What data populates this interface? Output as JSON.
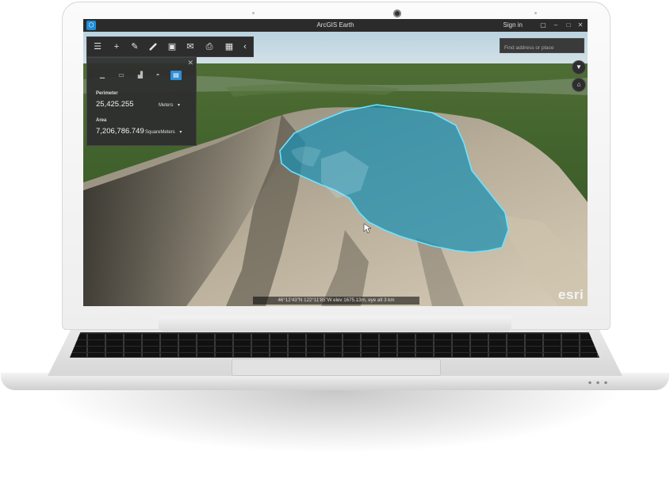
{
  "window": {
    "title": "ArcGIS Earth",
    "sign_in": "Sign in",
    "logo_glyph": "⬡"
  },
  "toolbar": {
    "items": [
      {
        "icon": "layers-list-icon",
        "glyph": "☰"
      },
      {
        "icon": "add-icon",
        "glyph": "+"
      },
      {
        "icon": "draw-icon",
        "glyph": "✎"
      },
      {
        "icon": "measure-icon",
        "glyph": "📏"
      },
      {
        "icon": "picture-icon",
        "glyph": "▣"
      },
      {
        "icon": "email-icon",
        "glyph": "✉"
      },
      {
        "icon": "print-icon",
        "glyph": "⎙"
      },
      {
        "icon": "grid-icon",
        "glyph": "▦"
      },
      {
        "icon": "collapse-icon",
        "glyph": "‹"
      }
    ]
  },
  "search": {
    "placeholder": "Find address or place"
  },
  "nav": {
    "compass_glyph": "▼",
    "home_glyph": "⌂"
  },
  "measure_panel": {
    "close_glyph": "✕",
    "tools": [
      {
        "icon": "measure-distance-icon",
        "glyph": "▁"
      },
      {
        "icon": "measure-area-icon",
        "glyph": "▭"
      },
      {
        "icon": "measure-height-icon",
        "glyph": "▟"
      },
      {
        "icon": "measure-volume-icon",
        "glyph": "◓"
      },
      {
        "icon": "measure-polygon-icon",
        "glyph": "▤",
        "active": true
      }
    ],
    "perimeter_label": "Perimeter",
    "perimeter_value": "25,425.255",
    "perimeter_unit": "Meters",
    "area_label": "Area",
    "area_value": "7,206,786.749",
    "area_unit": "SquareMeters",
    "dropdown_glyph": "▾"
  },
  "status": {
    "coords": "46°12'43\"N  122°11'85\"W  elev 1675.13m,  eye alt 3 km"
  },
  "brand": {
    "esri": "esri"
  },
  "colors": {
    "accent": "#2f8fd8",
    "polygon_fill": "#1b8fb1",
    "polygon_stroke": "#6fe3ff"
  }
}
